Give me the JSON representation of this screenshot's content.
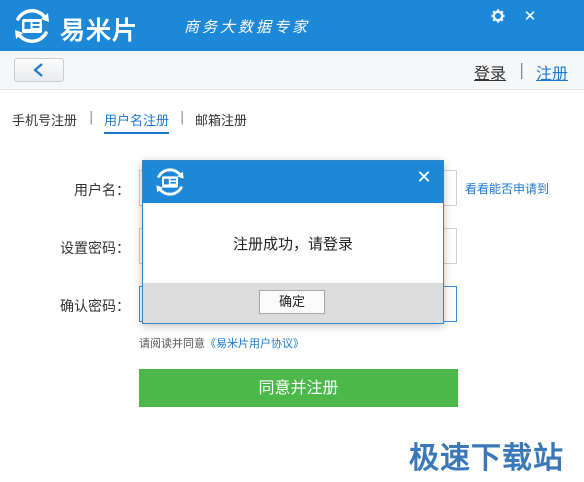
{
  "app": {
    "name": "易米片",
    "slogan": "商务大数据专家",
    "settings_icon": "gear-icon",
    "close_label": "✕"
  },
  "nav": {
    "back_icon": "chevron-left-icon",
    "login": "登录",
    "separator": "|",
    "register": "注册"
  },
  "tabs": [
    {
      "label": "手机号注册",
      "active": false
    },
    {
      "label": "用户名注册",
      "active": true
    },
    {
      "label": "邮箱注册",
      "active": false
    }
  ],
  "form": {
    "username_label": "用户名：",
    "password_label": "设置密码：",
    "confirm_label": "确认密码：",
    "check_link": "看看能否申请到",
    "agree_prefix": "请阅读并同意",
    "agree_link": "《易米片用户协议》",
    "submit": "同意并注册"
  },
  "dialog": {
    "message": "注册成功，请登录",
    "ok": "确定",
    "close_label": "✕"
  },
  "watermark": "极速下载站",
  "colors": {
    "brand_blue": "#1e88d8",
    "link_blue": "#1a7ad0",
    "submit_green": "#4cb84a"
  }
}
